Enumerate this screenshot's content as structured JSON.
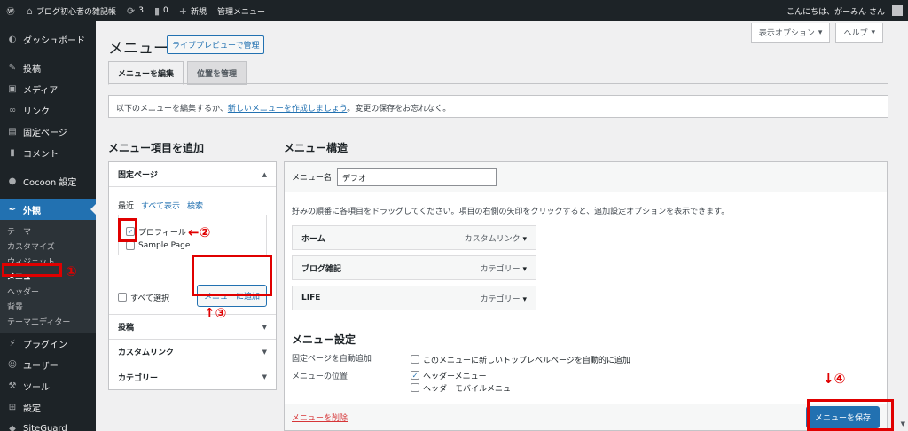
{
  "adminbar": {
    "site": "ブログ初心者の雑記帳",
    "updates": "3",
    "comments": "0",
    "new": "新規",
    "menu": "管理メニュー",
    "greeting": "こんにちは、がーみん さん"
  },
  "sidebar": {
    "items": [
      {
        "label": "ダッシュボード",
        "icon": "dashboard-icon"
      },
      {
        "label": "投稿",
        "icon": "pin-icon"
      },
      {
        "label": "メディア",
        "icon": "media-icon"
      },
      {
        "label": "リンク",
        "icon": "link-icon"
      },
      {
        "label": "固定ページ",
        "icon": "page-icon"
      },
      {
        "label": "コメント",
        "icon": "comment-icon"
      },
      {
        "label": "Cocoon 設定",
        "icon": "circle-icon"
      },
      {
        "label": "外観",
        "icon": "brush-icon"
      },
      {
        "label": "プラグイン",
        "icon": "plugin-icon"
      },
      {
        "label": "ユーザー",
        "icon": "user-icon"
      },
      {
        "label": "ツール",
        "icon": "wrench-icon"
      },
      {
        "label": "設定",
        "icon": "settings-icon"
      },
      {
        "label": "SiteGuard",
        "icon": "shield-icon"
      }
    ],
    "submenu": [
      "テーマ",
      "カスタマイズ",
      "ウィジェット",
      "メニュー",
      "ヘッダー",
      "背景",
      "テーマエディター"
    ]
  },
  "header": {
    "screen_options": "表示オプション",
    "help": "ヘルプ",
    "title": "メニュー",
    "live_preview": "ライブプレビューで管理",
    "tabs": [
      "メニューを編集",
      "位置を管理"
    ],
    "notice_before": "以下のメニューを編集するか、",
    "notice_link": "新しいメニューを作成しましょう",
    "notice_after": "。変更の保存をお忘れなく。"
  },
  "add_items": {
    "heading": "メニュー項目を追加",
    "panel_title": "固定ページ",
    "tabs": [
      "最近",
      "すべて表示",
      "検索"
    ],
    "pages": [
      {
        "label": "プロフィール",
        "checked": true
      },
      {
        "label": "Sample Page",
        "checked": false
      }
    ],
    "select_all": "すべて選択",
    "add_button": "メニューに追加",
    "other_panels": [
      "投稿",
      "カスタムリンク",
      "カテゴリー"
    ]
  },
  "structure": {
    "heading": "メニュー構造",
    "name_label": "メニュー名",
    "name_value": "デフオ",
    "instructions": "好みの順番に各項目をドラッグしてください。項目の右側の矢印をクリックすると、追加設定オプションを表示できます。",
    "entries": [
      {
        "title": "ホーム",
        "type": "カスタムリンク"
      },
      {
        "title": "ブログ雑記",
        "type": "カテゴリー"
      },
      {
        "title": "LIFE",
        "type": "カテゴリー"
      }
    ],
    "settings_heading": "メニュー設定",
    "auto_add_label": "固定ページを自動追加",
    "auto_add_option": "このメニューに新しいトップレベルページを自動的に追加",
    "location_label": "メニューの位置",
    "locations": [
      {
        "label": "ヘッダーメニュー",
        "checked": true
      },
      {
        "label": "ヘッダーモバイルメニュー",
        "checked": false
      }
    ],
    "delete": "メニューを削除",
    "save": "メニューを保存"
  },
  "annotations": [
    "①",
    "←②",
    "↑③",
    "↓④"
  ],
  "colors": {
    "accent": "#2271b1",
    "annotation": "#e00000",
    "sidebar": "#1d2327"
  }
}
